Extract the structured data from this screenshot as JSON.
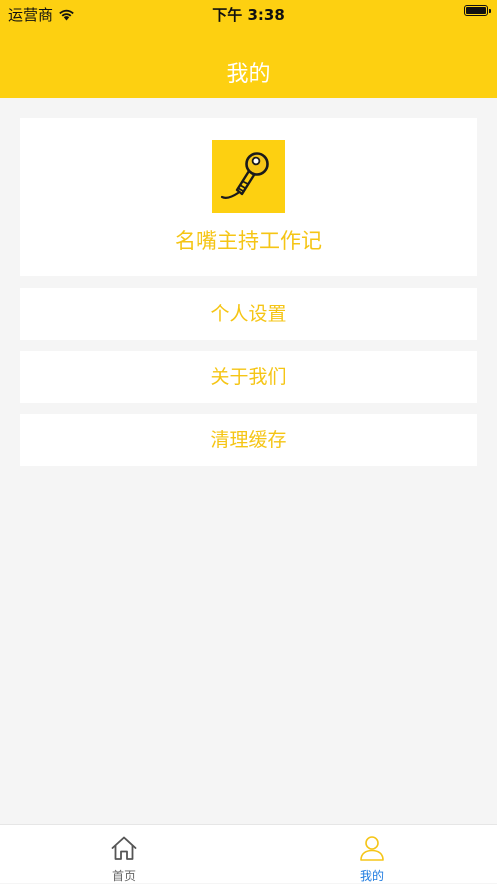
{
  "status_bar": {
    "carrier": "运营商",
    "time": "下午 3:38",
    "wifi_icon": "wifi-icon",
    "battery_icon": "battery-icon"
  },
  "header": {
    "title": "我的"
  },
  "profile": {
    "logo_icon": "microphone-logo-icon",
    "app_name": "名嘴主持工作记"
  },
  "menu": {
    "items": [
      {
        "label": "个人设置"
      },
      {
        "label": "关于我们"
      },
      {
        "label": "清理缓存"
      }
    ]
  },
  "tabbar": {
    "tabs": [
      {
        "label": "首页",
        "icon": "home-icon",
        "active": false
      },
      {
        "label": "我的",
        "icon": "user-icon",
        "active": true
      }
    ]
  },
  "colors": {
    "accent": "#fdd011",
    "menu_text": "#f5c515",
    "active_tab": "#1e7be0",
    "background": "#f5f5f5"
  }
}
